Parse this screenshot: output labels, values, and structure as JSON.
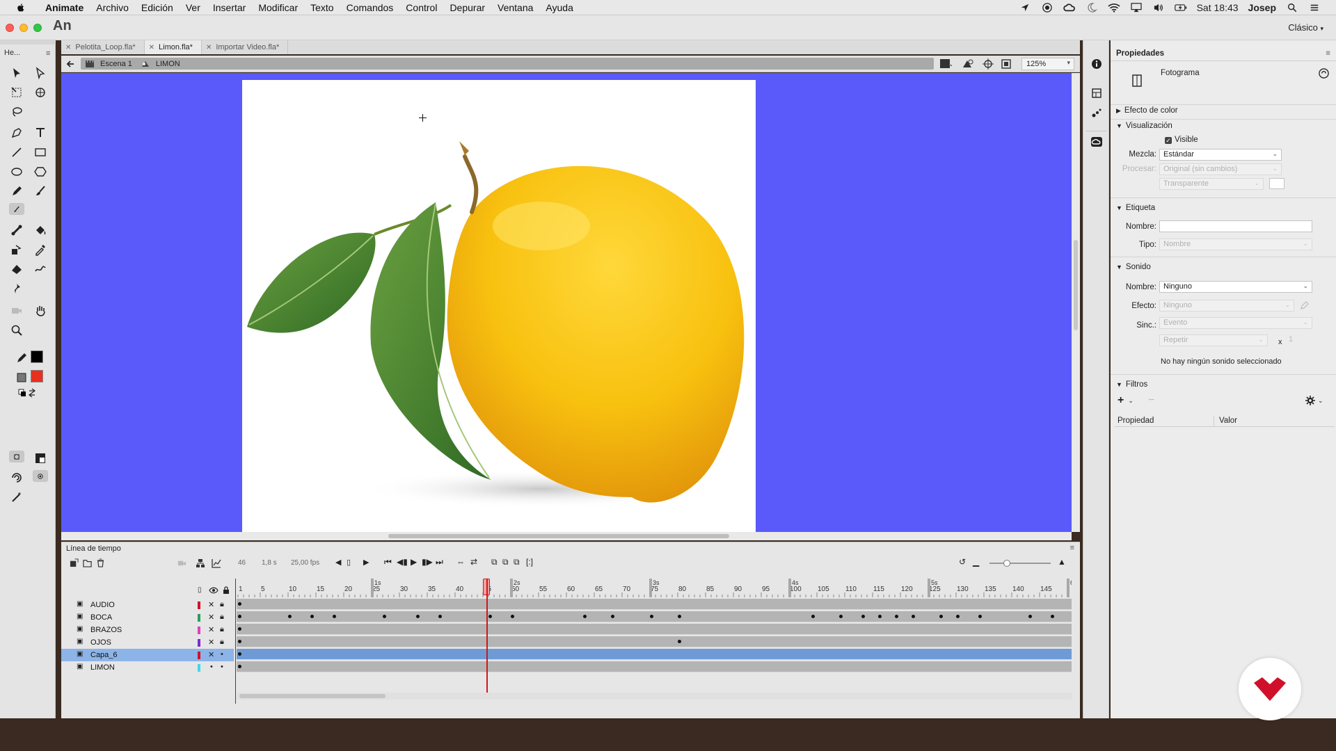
{
  "menubar": {
    "app": "Animate",
    "items": [
      "Archivo",
      "Edición",
      "Ver",
      "Insertar",
      "Modificar",
      "Texto",
      "Comandos",
      "Control",
      "Depurar",
      "Ventana",
      "Ayuda"
    ],
    "clock": "Sat 18:43",
    "user": "Josep",
    "status_icons": [
      "location-icon",
      "record-icon",
      "creative-cloud-icon",
      "moon-icon",
      "wifi-icon",
      "airplay-icon",
      "volume-icon",
      "battery-icon"
    ]
  },
  "app": {
    "logo": "An",
    "workspace": "Clásico"
  },
  "tools_panel": {
    "title": "He..."
  },
  "tabs": [
    {
      "label": "Pelotita_Loop.fla*",
      "active": false
    },
    {
      "label": "Limon.fla*",
      "active": true
    },
    {
      "label": "Importar Video.fla*",
      "active": false
    }
  ],
  "editbar": {
    "scene": "Escena 1",
    "symbol": "LIMON",
    "zoom": "125%"
  },
  "canvas": {
    "background": "#5a5afa",
    "stage_color": "#ffffff"
  },
  "properties": {
    "title": "Propiedades",
    "instance_type": "Fotograma",
    "color_effect": {
      "title": "Efecto de color"
    },
    "display": {
      "title": "Visualización",
      "visible_label": "Visible",
      "visible_checked": true,
      "blend_label": "Mezcla:",
      "blend_value": "Estándar",
      "render_label": "Procesar:",
      "render_value": "Original (sin cambios)",
      "bg_value": "Transparente"
    },
    "label": {
      "title": "Etiqueta",
      "name_label": "Nombre:",
      "name_value": "",
      "type_label": "Tipo:",
      "type_value": "Nombre"
    },
    "sound": {
      "title": "Sonido",
      "name_label": "Nombre:",
      "name_value": "Ninguno",
      "effect_label": "Efecto:",
      "effect_value": "Ninguno",
      "sync_label": "Sinc.:",
      "sync_value": "Evento",
      "repeat_value": "Repetir",
      "repeat_x": "x",
      "repeat_count": "1",
      "none_msg": "No hay ningún sonido seleccionado"
    },
    "filters": {
      "title": "Filtros",
      "col_property": "Propiedad",
      "col_value": "Valor"
    }
  },
  "timeline": {
    "title": "Línea de tiempo",
    "current_frame": "46",
    "time": "1,8 s",
    "fps": "25,00 fps",
    "ruler_numbers": [
      1,
      5,
      10,
      15,
      20,
      25,
      30,
      35,
      40,
      45,
      50,
      55,
      60,
      65,
      70,
      75,
      80,
      85,
      90,
      95,
      100,
      105,
      110,
      115,
      120,
      125,
      130,
      135,
      140,
      145
    ],
    "seconds_marks": [
      "1s",
      "2s",
      "3s",
      "4s",
      "5s",
      "6"
    ],
    "layers": [
      {
        "name": "AUDIO",
        "color": "#d0102a",
        "active": false
      },
      {
        "name": "BOCA",
        "color": "#2a9e5a",
        "active": false
      },
      {
        "name": "BRAZOS",
        "color": "#e040c0",
        "active": false
      },
      {
        "name": "OJOS",
        "color": "#7a2ad0",
        "active": false
      },
      {
        "name": "Capa_6",
        "color": "#d0102a",
        "active": true
      },
      {
        "name": "LIMON",
        "color": "#40d8e8",
        "active": false
      }
    ]
  },
  "brand_color": "#d0102a"
}
